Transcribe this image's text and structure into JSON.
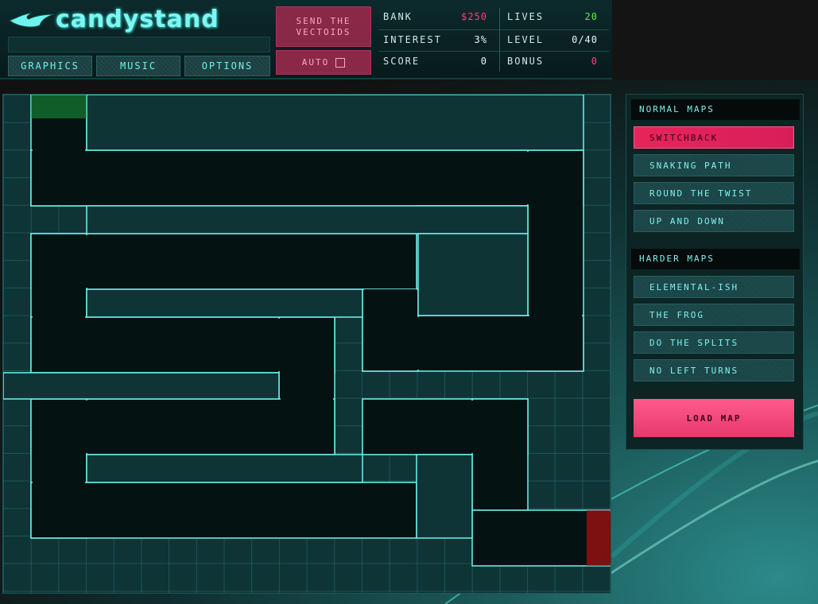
{
  "header": {
    "logo_text": "candystand",
    "menu": [
      "GRAPHICS",
      "MUSIC",
      "OPTIONS"
    ],
    "send_button": "SEND THE VECTOIDS",
    "auto_button": "AUTO"
  },
  "stats": {
    "bank_label": "BANK",
    "bank_value": "$250",
    "interest_label": "INTEREST",
    "interest_value": "3%",
    "score_label": "SCORE",
    "score_value": "0",
    "lives_label": "LIVES",
    "lives_value": "20",
    "level_label": "LEVEL",
    "level_value": "0/40",
    "bonus_label": "BONUS",
    "bonus_value": "0"
  },
  "panel": {
    "normal_title": "NORMAL MAPS",
    "normal_maps": [
      "SWITCHBACK",
      "SNAKING PATH",
      "ROUND THE TWIST",
      "UP AND DOWN"
    ],
    "harder_title": "HARDER MAPS",
    "harder_maps": [
      "ELEMENTAL-ISH",
      "THE FROG",
      "DO THE SPLITS",
      "NO LEFT TURNS"
    ],
    "selected_map": "SWITCHBACK",
    "load_button": "LOAD MAP"
  },
  "colors": {
    "accent_pink": "#e8245a",
    "lives_green": "#5ef03a",
    "grid_teal": "#3ee7e2",
    "entry_green": "#1c9a3c",
    "exit_red": "#b01010"
  }
}
